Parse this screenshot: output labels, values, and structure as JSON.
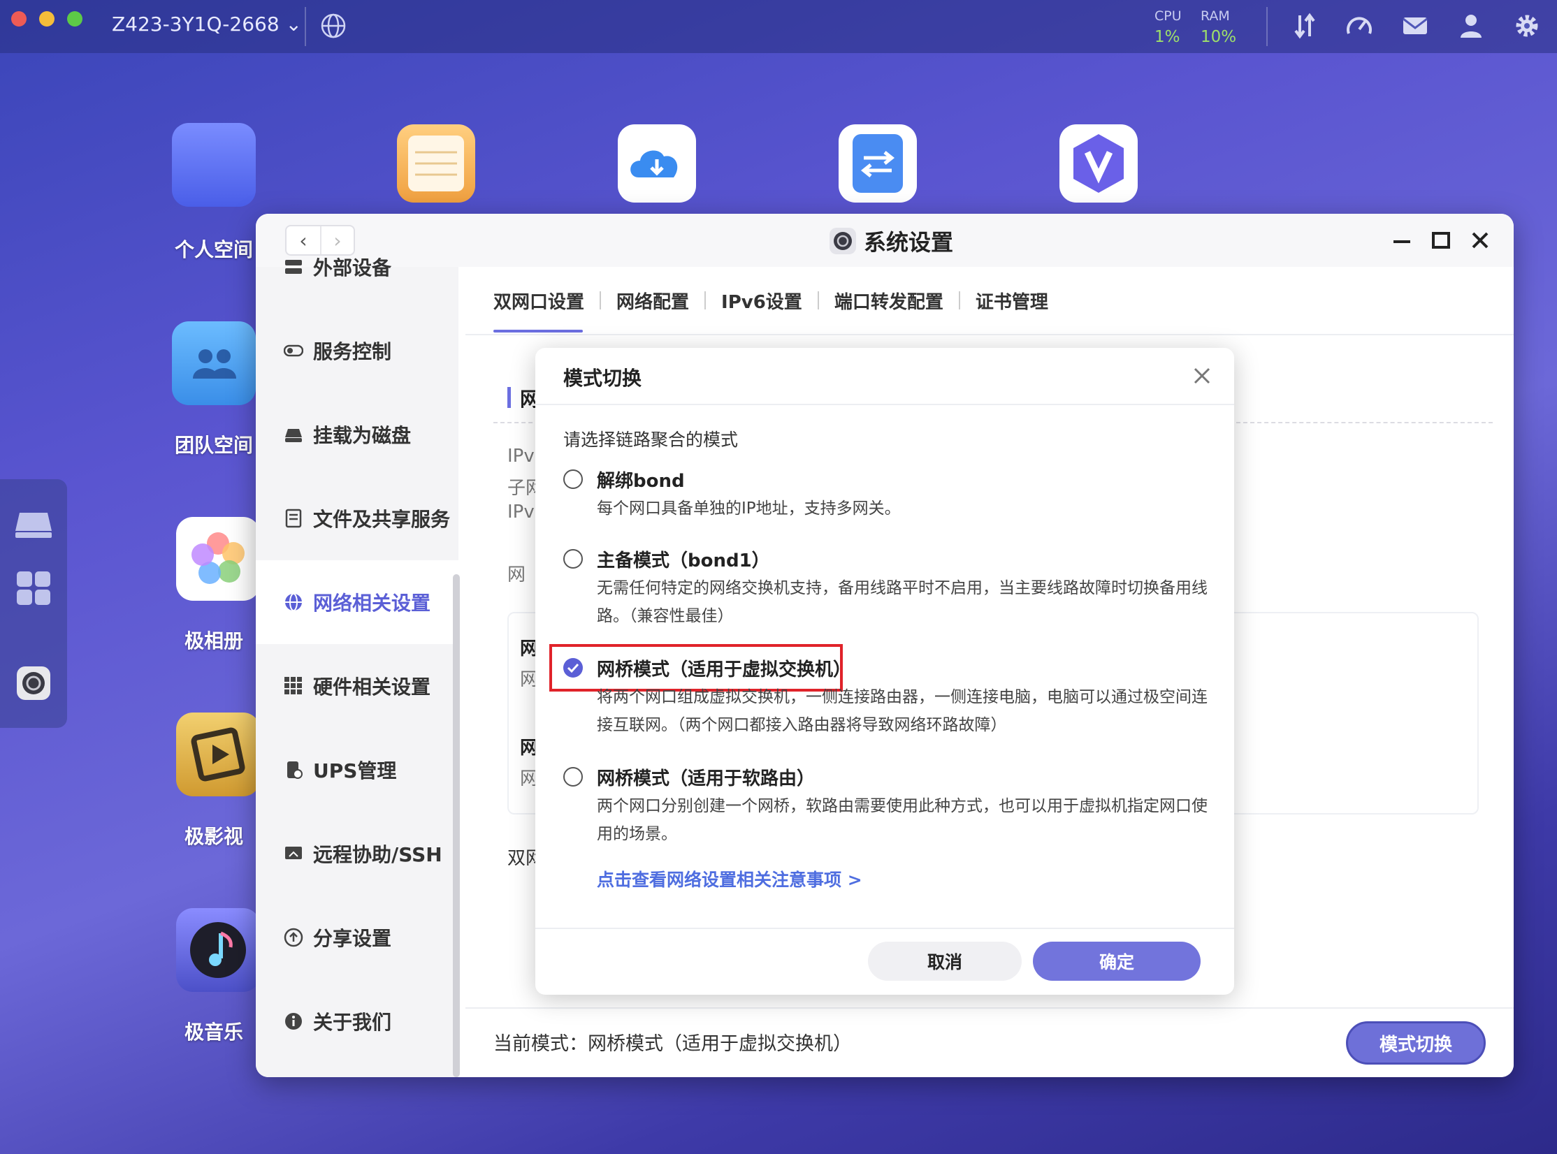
{
  "topbar": {
    "device_name": "Z423-3Y1Q-2668 ⌄",
    "cpu_label": "CPU",
    "cpu_value": "1%",
    "ram_label": "RAM",
    "ram_value": "10%"
  },
  "desktop": {
    "icons": [
      {
        "label": "个人空间"
      },
      {
        "label": "团队空间"
      },
      {
        "label": "极相册"
      },
      {
        "label": "极影视"
      },
      {
        "label": "极音乐"
      }
    ]
  },
  "window": {
    "title": "系统设置",
    "nav_back": "‹",
    "nav_forward": "›"
  },
  "sidebar": {
    "items": [
      {
        "label": "外部设备"
      },
      {
        "label": "服务控制"
      },
      {
        "label": "挂载为磁盘"
      },
      {
        "label": "文件及共享服务"
      },
      {
        "label": "网络相关设置"
      },
      {
        "label": "硬件相关设置"
      },
      {
        "label": "UPS管理"
      },
      {
        "label": "远程协助/SSH"
      },
      {
        "label": "分享设置"
      },
      {
        "label": "关于我们"
      }
    ]
  },
  "tabs": [
    {
      "label": "双网口设置"
    },
    {
      "label": "网络配置"
    },
    {
      "label": "IPv6设置"
    },
    {
      "label": "端口转发配置"
    },
    {
      "label": "证书管理"
    }
  ],
  "content": {
    "section_fragment": "网",
    "frag_ipv4": "IPv",
    "frag_subnet": "子网",
    "frag_ipv4b": "IPv",
    "frag_gateway": "网",
    "frag_card1": "网",
    "frag_card2": "网",
    "frag_card3": "网",
    "frag_card4": "网",
    "frag_dual": "双网",
    "current_mode": "当前模式：网桥模式（适用于虚拟交换机）",
    "mode_switch_button": "模式切换"
  },
  "modal": {
    "title": "模式切换",
    "prompt": "请选择链路聚合的模式",
    "options": [
      {
        "title": "解绑bond",
        "desc": "每个网口具备单独的IP地址，支持多网关。",
        "checked": false
      },
      {
        "title": "主备模式（bond1）",
        "desc": "无需任何特定的网络交换机支持，备用线路平时不启用，当主要线路故障时切换备用线路。（兼容性最佳）",
        "checked": false
      },
      {
        "title": "网桥模式（适用于虚拟交换机）",
        "desc": "将两个网口组成虚拟交换机，一侧连接路由器，一侧连接电脑，电脑可以通过极空间连接互联网。（两个网口都接入路由器将导致网络环路故障）",
        "checked": true
      },
      {
        "title": "网桥模式（适用于软路由）",
        "desc": "两个网口分别创建一个网桥，软路由需要使用此种方式，也可以用于虚拟机指定网口使用的场景。",
        "checked": false
      }
    ],
    "link": "点击查看网络设置相关注意事项 >",
    "cancel": "取消",
    "ok": "确定"
  },
  "colors": {
    "accent": "#5b5fd6",
    "highlight": "#e0232a",
    "link": "#4f6ee0"
  }
}
